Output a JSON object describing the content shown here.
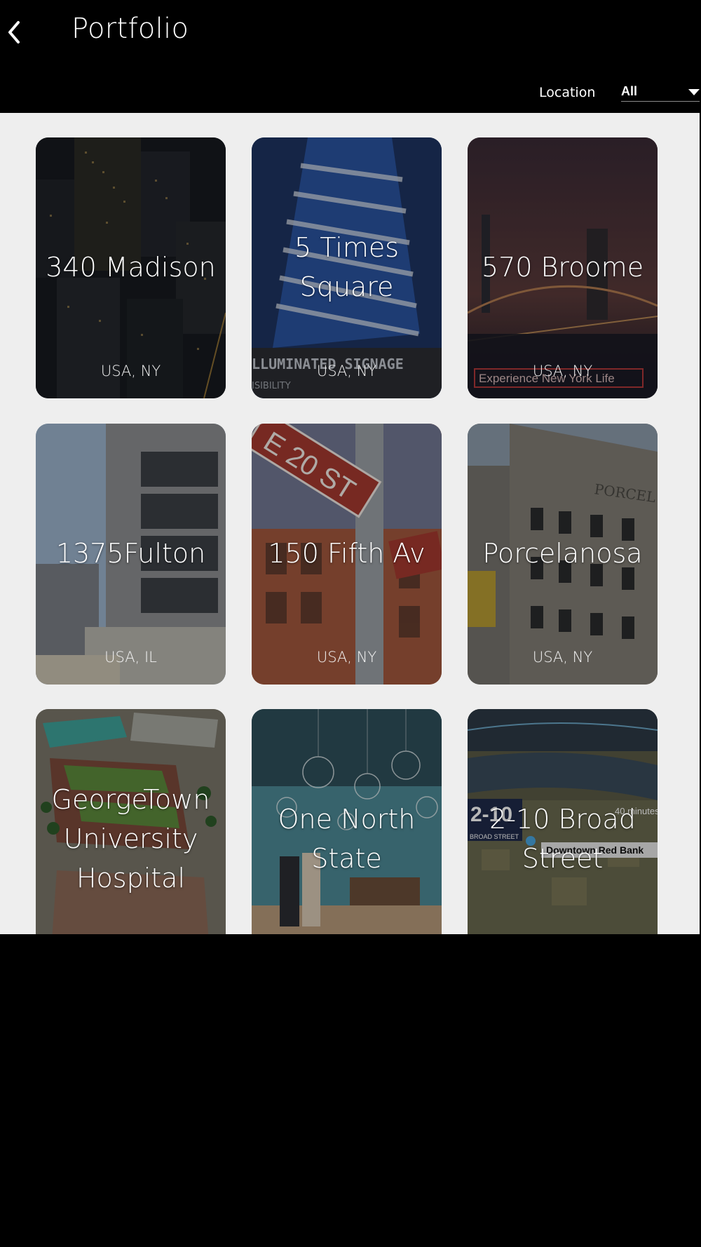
{
  "header": {
    "back_icon": "chevron-left-icon",
    "title": "Portfolio"
  },
  "filter": {
    "label": "Location",
    "selected": "All",
    "caret_icon": "caret-down-icon"
  },
  "cards": [
    {
      "title": "340 Madison",
      "location": "USA, NY"
    },
    {
      "title": "5 Times Square",
      "location": "USA, NY"
    },
    {
      "title": "570 Broome",
      "location": "USA, NY"
    },
    {
      "title": "1375Fulton",
      "location": "USA, IL"
    },
    {
      "title": "150 Fifth Av",
      "location": "USA, NY"
    },
    {
      "title": "Porcelanosa",
      "location": "USA, NY"
    },
    {
      "title": "GeorgeTown University Hospital",
      "location": ""
    },
    {
      "title": "One North State",
      "location": ""
    },
    {
      "title": "2-10 Broad Street",
      "location": ""
    }
  ],
  "image_text": {
    "signage": "LLUMINATED SIGNAGE",
    "visibility": "ISIBILITY",
    "broome_banner": "Experience New York Life",
    "street_sign": "E 20 ST",
    "building_sign": "PORCEL",
    "map_badge": "2-10",
    "map_badge_sub": "BROAD STREET",
    "map_minutes": "40 minutes",
    "map_station": "Downtown Red Bank"
  }
}
